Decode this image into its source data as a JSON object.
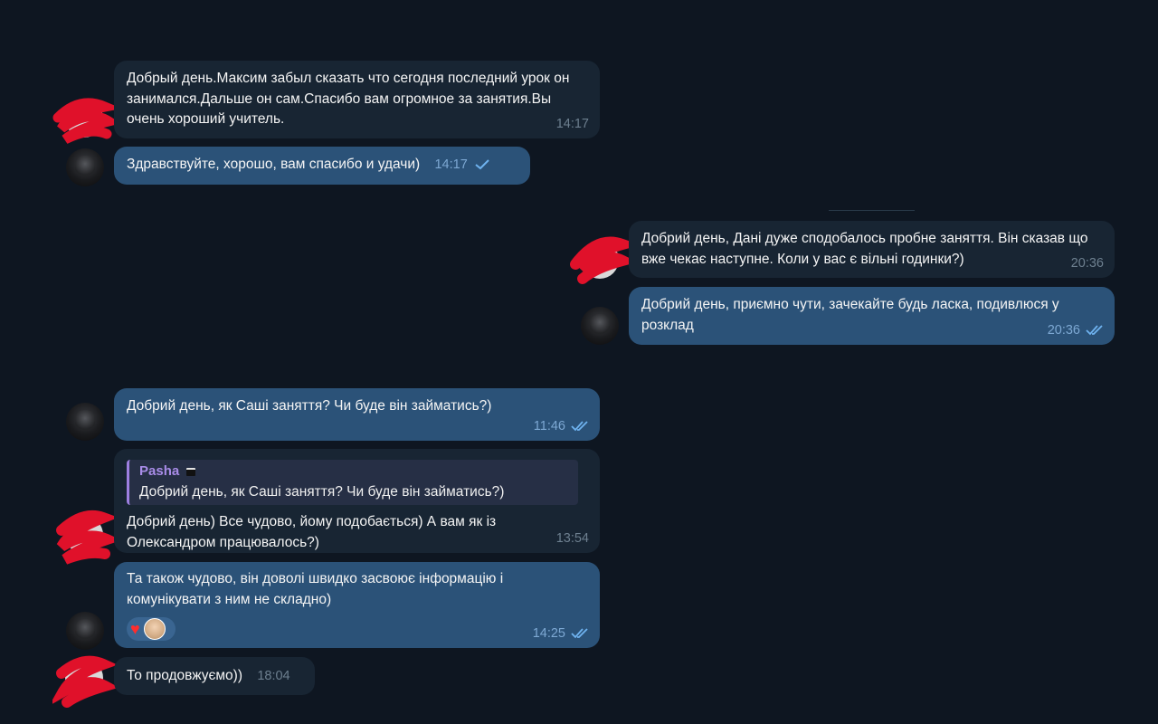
{
  "messages": [
    {
      "id": "m1",
      "text": "Добрый день.Максим забыл сказать что сегодня последний урок он занимался.Дальше он сам.Спасибо вам огромное за занятия.Вы очень хороший учитель.",
      "time": "14:17"
    },
    {
      "id": "m2",
      "text": "Здравствуйте, хорошо, вам спасибо и удачи)",
      "time": "14:17",
      "status": "sent"
    },
    {
      "id": "m3",
      "text": "Добрий день, Дані дуже сподобалось пробне заняття. Він сказав що вже чекає наступне. Коли у вас є вільні годинки?)",
      "time": "20:36"
    },
    {
      "id": "m4",
      "text": "Добрий день, приємно чути, зачекайте будь ласка, подивлюся у розклад",
      "time": "20:36",
      "status": "read"
    },
    {
      "id": "m5",
      "text": "Добрий день, як Саші заняття? Чи буде він займатись?)",
      "time": "11:46",
      "status": "read"
    },
    {
      "id": "m6",
      "reply_to": {
        "name": "Pasha",
        "text": "Добрий день, як Саші заняття? Чи буде він займатись?)"
      },
      "text": "Добрий день) Все чудово, йому подобається) А вам як із Олександром працювалось?)",
      "time": "13:54"
    },
    {
      "id": "m7",
      "text": "Та також чудово, він доволі швидко засвоює інформацію і комунікувати з ним не складно)",
      "time": "14:25",
      "status": "read",
      "reactions": [
        {
          "type": "heart-icon"
        },
        {
          "type": "user-avatar"
        }
      ]
    },
    {
      "id": "m8",
      "text": "То продовжуємо))",
      "time": "18:04"
    }
  ],
  "colors": {
    "background": "#0e1621",
    "incoming_bubble": "#182533",
    "outgoing_bubble": "#2b5278",
    "reply_accent": "#9d7fe0",
    "scribble": "#e0112a"
  }
}
